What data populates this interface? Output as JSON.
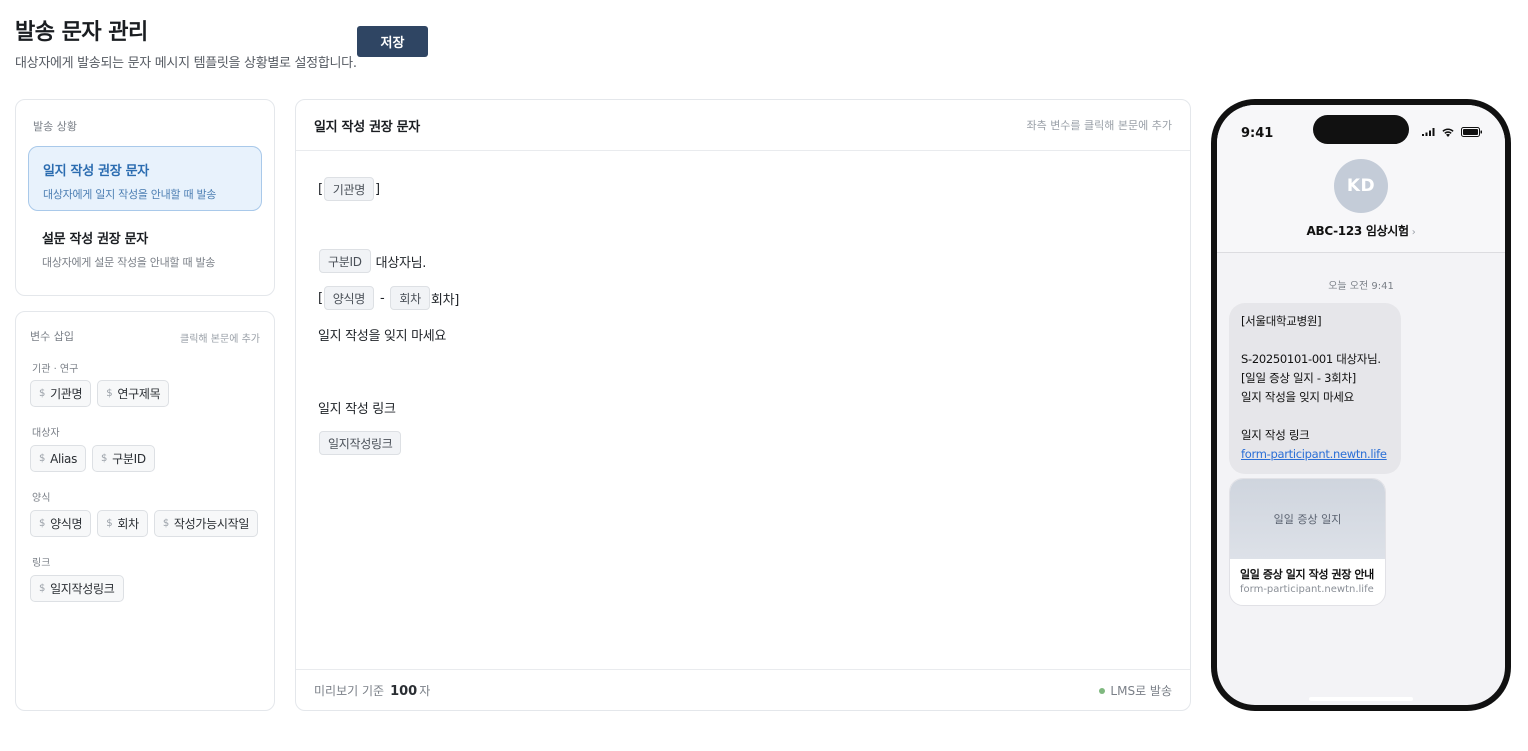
{
  "header": {
    "title": "발송 문자 관리",
    "subtitle": "대상자에게 발송되는 문자 메시지 템플릿을 상황별로 설정합니다.",
    "save_label": "저장"
  },
  "situations": {
    "label": "발송 상황",
    "items": [
      {
        "title": "일지 작성 권장 문자",
        "desc": "대상자에게 일지 작성을 안내할 때 발송",
        "active": true
      },
      {
        "title": "설문 작성 권장 문자",
        "desc": "대상자에게 설문 작성을 안내할 때 발송",
        "active": false
      }
    ]
  },
  "variables": {
    "label": "변수 삽입",
    "hint": "클릭해 본문에 추가",
    "symbol": "$",
    "groups": [
      {
        "label": "기관 · 연구",
        "items": [
          "기관명",
          "연구제목"
        ]
      },
      {
        "label": "대상자",
        "items": [
          "Alias",
          "구분ID"
        ]
      },
      {
        "label": "양식",
        "items": [
          "양식명",
          "회차",
          "작성가능시작일"
        ]
      },
      {
        "label": "링크",
        "items": [
          "일지작성링크"
        ]
      }
    ]
  },
  "editor": {
    "title": "일지 작성 권장 문자",
    "hint": "좌측 변수를 클릭해 본문에 추가",
    "body": {
      "bracket_open": "[",
      "bracket_close": "]",
      "token_org": "기관명",
      "token_id": "구분ID",
      "id_suffix": "대상자님.",
      "token_form": "양식명",
      "dash": "-",
      "token_round": "회차",
      "round_suffix": "회차]",
      "reminder": "일지 작성을 잊지 마세요",
      "link_label": "일지 작성 링크",
      "token_link": "일지작성링크"
    },
    "footer": {
      "preview_label": "미리보기 기준",
      "count": "100",
      "unit": "자",
      "send_type": "LMS로 발송",
      "send_dot_color": "#7fb87f"
    }
  },
  "phone": {
    "time": "9:41",
    "avatar_initials": "KD",
    "contact_name": "ABC-123 임상시험",
    "contact_chevron": "›",
    "message_time": "오늘 오전 9:41",
    "message": {
      "line1": "[서울대학교병원]",
      "line2": "S-20250101-001 대상자님.",
      "line3": "[일일 증상 일지 - 3회차]",
      "line4": "일지 작성을 잊지 마세요",
      "line5": "일지 작성 링크",
      "link": "form-participant.newtn.life"
    },
    "card": {
      "image_text": "일일 증상 일지",
      "title": "일일 증상 일지 작성 권장 안내",
      "url": "form-participant.newtn.life"
    }
  }
}
